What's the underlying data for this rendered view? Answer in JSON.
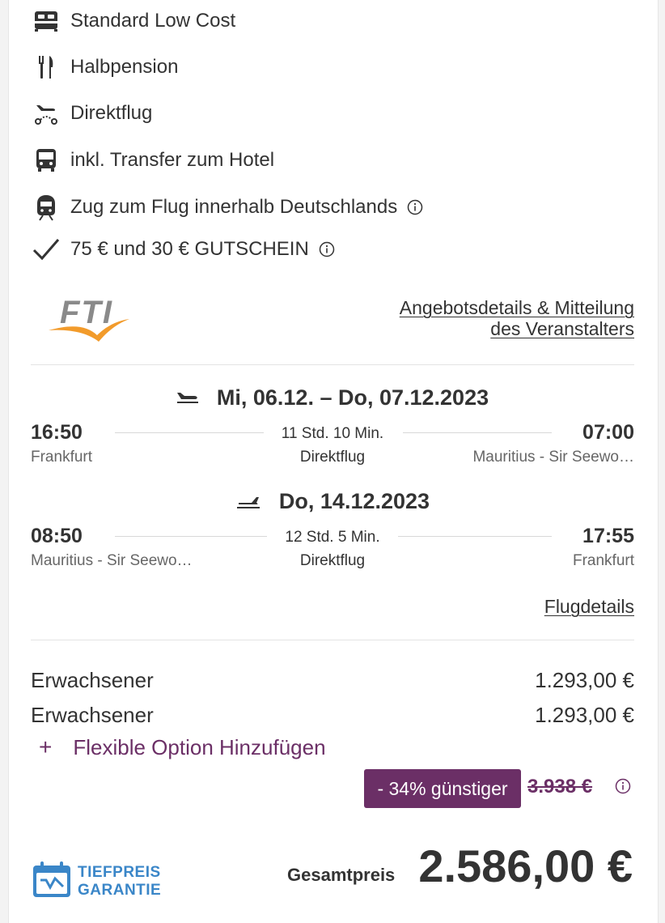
{
  "features": [
    {
      "icon": "bed-icon",
      "label": "Standard Low Cost"
    },
    {
      "icon": "fork-knife-icon",
      "label": "Halbpension"
    },
    {
      "icon": "direct-flight-icon",
      "label": "Direktflug"
    },
    {
      "icon": "bus-icon",
      "label": "inkl. Transfer zum Hotel"
    },
    {
      "icon": "train-icon",
      "label": "Zug zum Flug innerhalb Deutschlands"
    },
    {
      "icon": "checkmark-icon",
      "label": "75 € und 30 € GUTSCHEIN"
    }
  ],
  "operator": {
    "logo_text": "FTI",
    "details_link_line1": "Angebotsdetails & Mitteilung",
    "details_link_line2": "des Veranstalters"
  },
  "outbound": {
    "date": "Mi, 06.12. – Do, 07.12.2023",
    "depart_time": "16:50",
    "depart_place": "Frankfurt",
    "duration": "11 Std. 10 Min.",
    "type": "Direktflug",
    "arrive_time": "07:00",
    "arrive_place": "Mauritius - Sir Seewo…"
  },
  "inbound": {
    "date": "Do, 14.12.2023",
    "depart_time": "08:50",
    "depart_place": "Mauritius - Sir Seewo…",
    "duration": "12 Std. 5 Min.",
    "type": "Direktflug",
    "arrive_time": "17:55",
    "arrive_place": "Frankfurt"
  },
  "flight_details_link": "Flugdetails",
  "prices": [
    {
      "label": "Erwachsener",
      "value": "1.293,00 €"
    },
    {
      "label": "Erwachsener",
      "value": "1.293,00 €"
    }
  ],
  "flexible_option": {
    "plus": "+",
    "label": "Flexible Option Hinzufügen"
  },
  "discount_badge": "- 34% günstiger",
  "old_price": "3.938 €",
  "total_label": "Gesamtpreis",
  "total_price": "2.586,00 €",
  "tiefpreis": {
    "line1": "TIEFPREIS",
    "line2": "GARANTIE"
  },
  "colors": {
    "accent": "#6b2f66",
    "text": "#333333",
    "muted": "#666666",
    "brand_blue": "#3a86c8",
    "fti_orange": "#f29b2b"
  }
}
